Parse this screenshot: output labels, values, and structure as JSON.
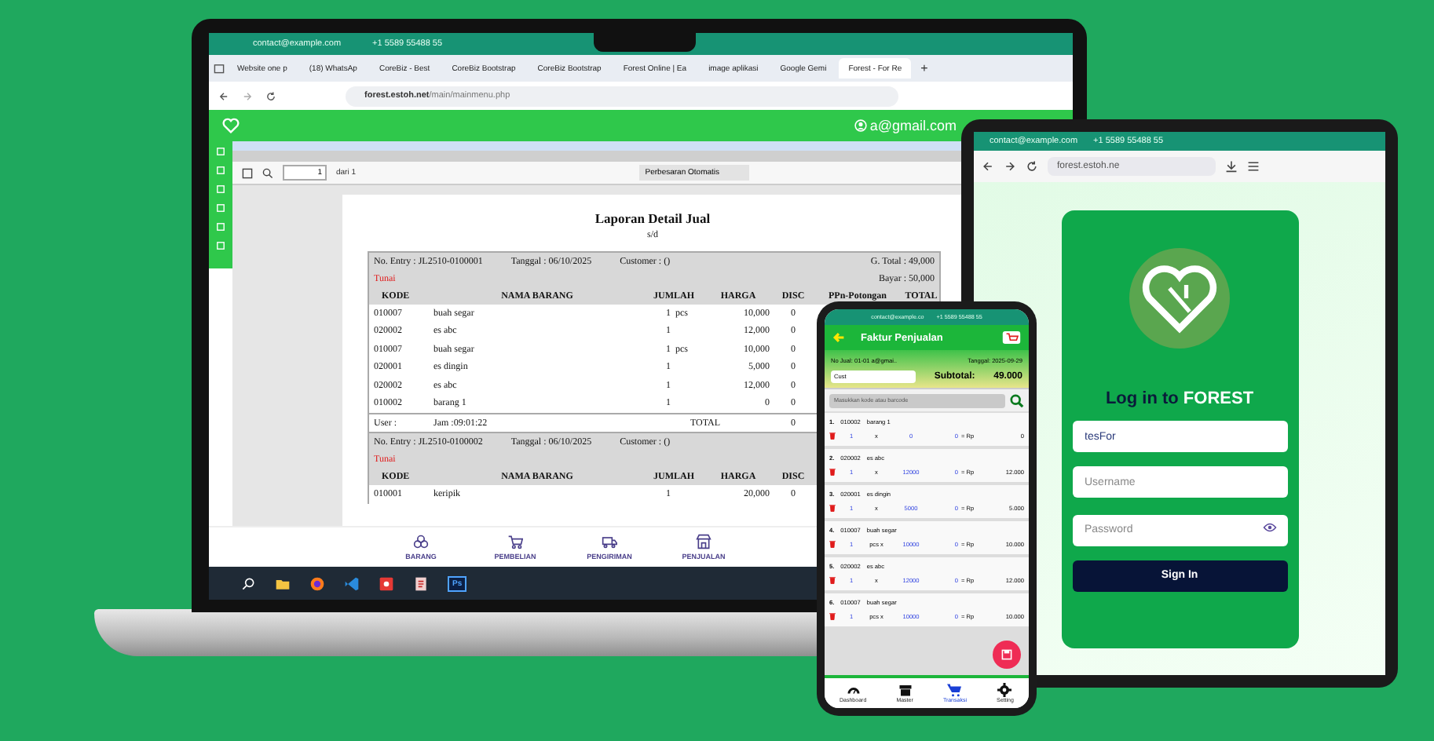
{
  "laptop": {
    "contact_bar": {
      "email": "contact@example.com",
      "phone": "+1 5589 55488 55"
    },
    "tabs": [
      {
        "label": "Website one p",
        "selected": false
      },
      {
        "label": "(18) WhatsAp",
        "selected": false
      },
      {
        "label": "CoreBiz - Best",
        "selected": false
      },
      {
        "label": "CoreBiz Bootstrap",
        "selected": false
      },
      {
        "label": "CoreBiz Bootstrap",
        "selected": false
      },
      {
        "label": "Forest Online | Ea",
        "selected": false
      },
      {
        "label": "image aplikasi",
        "selected": false
      },
      {
        "label": "Google Gemi",
        "selected": false
      },
      {
        "label": "Forest - For Re",
        "selected": true
      }
    ],
    "new_tab": "+",
    "url": {
      "host": "forest.estoh.net",
      "path": "/main/mainmenu.php"
    },
    "user": "a@gmail.com",
    "pdf_toolbar": {
      "page": "1",
      "page_count": "dari 1",
      "zoom": "Perbesaran Otomatis"
    },
    "report": {
      "title": "Laporan Detail Jual",
      "subtitle": "s/d",
      "entries": [
        {
          "entry": "No. Entry  : JL2510-0100001",
          "date": "Tanggal  : 06/10/2025",
          "customer": "Customer  : ()",
          "grand_total": "G. Total : 49,000",
          "payment": "Tunai",
          "paid": "Bayar : 50,000",
          "columns": [
            "KODE",
            "NAMA BARANG",
            "JUMLAH",
            "HARGA",
            "DISC",
            "PPn-Potongan",
            "TOTAL"
          ],
          "rows": [
            {
              "code": "010007",
              "name": "buah segar",
              "qty": "1",
              "unit": "pcs",
              "price": "10,000",
              "disc": "0"
            },
            {
              "code": "020002",
              "name": "es abc",
              "qty": "1",
              "price": "12,000",
              "disc": "0"
            },
            {
              "code": "010007",
              "name": "buah segar",
              "qty": "1",
              "unit": "pcs",
              "price": "10,000",
              "disc": "0"
            },
            {
              "code": "020001",
              "name": "es dingin",
              "qty": "1",
              "price": "5,000",
              "disc": "0"
            },
            {
              "code": "020002",
              "name": "es abc",
              "qty": "1",
              "price": "12,000",
              "disc": "0"
            },
            {
              "code": "010002",
              "name": "barang 1",
              "qty": "1",
              "price": "0",
              "disc": "0"
            }
          ],
          "footer": {
            "user": "User :",
            "time": "Jam :09:01:22",
            "total_label": "TOTAL",
            "disc_total": "0"
          }
        },
        {
          "entry": "No. Entry  : JL2510-0100002",
          "date": "Tanggal  : 06/10/2025",
          "customer": "Customer  : ()",
          "payment": "Tunai",
          "columns": [
            "KODE",
            "NAMA BARANG",
            "JUMLAH",
            "HARGA",
            "DISC"
          ],
          "rows": [
            {
              "code": "010001",
              "name": "keripik",
              "qty": "1",
              "price": "20,000",
              "disc": "0"
            }
          ]
        }
      ]
    },
    "nav": [
      {
        "label": "BARANG",
        "kind": "boxes"
      },
      {
        "label": "PEMBELIAN",
        "kind": "cart"
      },
      {
        "label": "PENGIRIMAN",
        "kind": "truck"
      },
      {
        "label": "PENJUALAN",
        "kind": "store"
      }
    ],
    "taskbar": {
      "photo_app_label": "Ps"
    }
  },
  "tablet": {
    "contact": "contact@example.com",
    "phone": "+1 5589 55488 55",
    "url": "forest.estoh.ne",
    "login": {
      "title_lead": "Log in to",
      "title_brand": "FOREST",
      "fields": [
        {
          "kind": "text",
          "value": "tesFor"
        },
        {
          "kind": "text",
          "placeholder": "Username"
        },
        {
          "kind": "password",
          "placeholder": "Password"
        }
      ],
      "button": "Sign In"
    }
  },
  "phone": {
    "contact": "contact@example.co",
    "phone": "+1 5589 55488 55",
    "title": "Faktur Penjualan",
    "sale_no": "No Jual: 01-01 a@gmai..",
    "date": "Tanggal: 2025-09-29",
    "customer": "Cust",
    "subtotal_label": "Subtotal:",
    "subtotal": "49.000",
    "search_placeholder": "Masukkan kode atau barcode",
    "items": [
      {
        "no": "1.",
        "code": "010002",
        "name": "barang 1",
        "qty": "1",
        "unit": "x",
        "price": "0",
        "disc": "0",
        "rp": "= Rp",
        "total": "0"
      },
      {
        "no": "2.",
        "code": "020002",
        "name": "es abc",
        "qty": "1",
        "unit": "x",
        "price": "12000",
        "disc": "0",
        "rp": "= Rp",
        "total": "12.000"
      },
      {
        "no": "3.",
        "code": "020001",
        "name": "es dingin",
        "qty": "1",
        "unit": "x",
        "price": "5000",
        "disc": "0",
        "rp": "= Rp",
        "total": "5.000"
      },
      {
        "no": "4.",
        "code": "010007",
        "name": "buah segar",
        "qty": "1",
        "unit": "pcs x",
        "price": "10000",
        "disc": "0",
        "rp": "= Rp",
        "total": "10.000"
      },
      {
        "no": "5.",
        "code": "020002",
        "name": "es abc",
        "qty": "1",
        "unit": "x",
        "price": "12000",
        "disc": "0",
        "rp": "= Rp",
        "total": "12.000"
      },
      {
        "no": "6.",
        "code": "010007",
        "name": "buah segar",
        "qty": "1",
        "unit": "pcs x",
        "price": "10000",
        "disc": "0",
        "rp": "= Rp",
        "total": "10.000"
      }
    ],
    "nav": [
      {
        "label": "Dashboard",
        "kind": "gauge",
        "selected": false
      },
      {
        "label": "Master",
        "kind": "box",
        "selected": false
      },
      {
        "label": "Transaksi",
        "kind": "cart",
        "selected": true
      },
      {
        "label": "Setting",
        "kind": "gear",
        "selected": false
      }
    ]
  }
}
